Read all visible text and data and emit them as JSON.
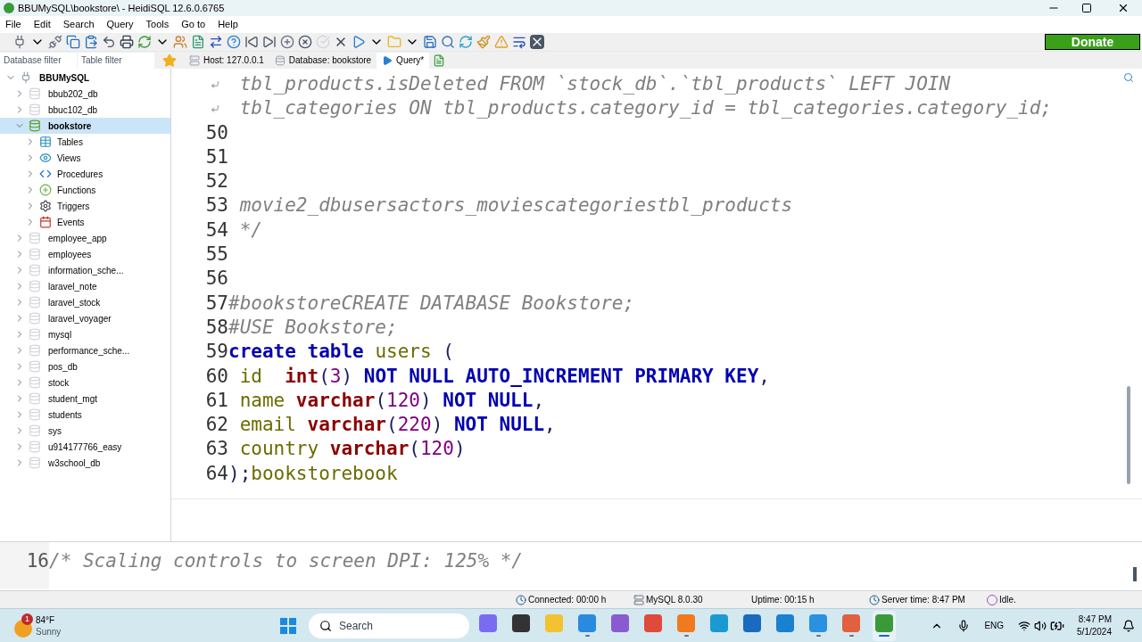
{
  "window": {
    "title": "BBUMySQL\\bookstore\\ - HeidiSQL 12.6.0.6765"
  },
  "menu": [
    "File",
    "Edit",
    "Search",
    "Query",
    "Tools",
    "Go to",
    "Help"
  ],
  "donate": {
    "label": "Donate"
  },
  "filters": [
    {
      "placeholder": "Database filter"
    },
    {
      "placeholder": "Table filter"
    }
  ],
  "tabs": [
    {
      "label": "Host: 127.0.0.1",
      "kind": "host",
      "selected": false
    },
    {
      "label": "Database: bookstore",
      "kind": "database",
      "selected": false
    },
    {
      "label": "Query*",
      "kind": "query",
      "selected": true
    }
  ],
  "tree": {
    "label": "BBUMySQL",
    "expanded": true,
    "children": [
      {
        "label": "bbub202_db",
        "kind": "database",
        "selected": false,
        "expanded": false
      },
      {
        "label": "bbuc102_db",
        "kind": "database",
        "selected": false,
        "expanded": false
      },
      {
        "label": "bookstore",
        "kind": "database",
        "selected": true,
        "expanded": true,
        "children": [
          {
            "label": "Tables",
            "kind": "tables"
          },
          {
            "label": "Views",
            "kind": "views"
          },
          {
            "label": "Procedures",
            "kind": "procedures"
          },
          {
            "label": "Functions",
            "kind": "functions"
          },
          {
            "label": "Triggers",
            "kind": "triggers"
          },
          {
            "label": "Events",
            "kind": "events"
          }
        ]
      },
      {
        "label": "employee_app",
        "kind": "database",
        "selected": false,
        "expanded": false
      },
      {
        "label": "employees",
        "kind": "database",
        "selected": false,
        "expanded": false
      },
      {
        "label": "information_sche...",
        "kind": "database",
        "selected": false,
        "expanded": false
      },
      {
        "label": "laravel_note",
        "kind": "database",
        "selected": false,
        "expanded": false
      },
      {
        "label": "laravel_stock",
        "kind": "database",
        "selected": false,
        "expanded": false
      },
      {
        "label": "laravel_voyager",
        "kind": "database",
        "selected": false,
        "expanded": false
      },
      {
        "label": "mysql",
        "kind": "database",
        "selected": false,
        "expanded": false
      },
      {
        "label": "performance_sche...",
        "kind": "database",
        "selected": false,
        "expanded": false
      },
      {
        "label": "pos_db",
        "kind": "database",
        "selected": false,
        "expanded": false
      },
      {
        "label": "stock",
        "kind": "database",
        "selected": false,
        "expanded": false
      },
      {
        "label": "student_mgt",
        "kind": "database",
        "selected": false,
        "expanded": false
      },
      {
        "label": "students",
        "kind": "database",
        "selected": false,
        "expanded": false
      },
      {
        "label": "sys",
        "kind": "database",
        "selected": false,
        "expanded": false
      },
      {
        "label": "u914177766_easy",
        "kind": "database",
        "selected": false,
        "expanded": false
      },
      {
        "label": "w3school_db",
        "kind": "database",
        "selected": false,
        "expanded": false
      }
    ]
  },
  "editor": {
    "lines": [
      {
        "tokens": [
          {
            "kind": "comment",
            "text": " tbl_products.isDeleted FROM `stock_db`.`tbl_products` LEFT JOIN"
          }
        ]
      },
      {
        "tokens": [
          {
            "kind": "comment",
            "text": " tbl_categories ON tbl_products.category_id = tbl_categories.category_id;"
          }
        ]
      },
      {
        "number": "50"
      },
      {
        "number": "51"
      },
      {
        "number": "52"
      },
      {
        "number": "53",
        "tokens": [
          {
            "kind": "comment",
            "text": " movie2_dbusersactors_moviescategoriestbl_products"
          }
        ]
      },
      {
        "number": "54",
        "tokens": [
          {
            "kind": "comment",
            "text": " */"
          }
        ]
      },
      {
        "number": "55"
      },
      {
        "number": "56"
      },
      {
        "number": "57",
        "tokens": [
          {
            "kind": "comment",
            "text": "#bookstoreCREATE DATABASE Bookstore;"
          }
        ]
      },
      {
        "number": "58",
        "tokens": [
          {
            "kind": "comment",
            "text": "#USE Bookstore;"
          }
        ]
      },
      {
        "number": "59",
        "tokens": [
          {
            "kind": "keyword",
            "text": "create table "
          },
          {
            "kind": "ident",
            "text": "users "
          },
          {
            "kind": "plain",
            "text": "("
          }
        ]
      },
      {
        "number": "60",
        "tokens": [
          {
            "kind": "ident",
            "text": " id  "
          },
          {
            "kind": "type",
            "text": "int"
          },
          {
            "kind": "plain",
            "text": "("
          },
          {
            "kind": "number",
            "text": "3"
          },
          {
            "kind": "plain",
            "text": ") "
          },
          {
            "kind": "keyword",
            "text": "NOT NULL AUTO_INCREMENT PRIMARY KEY"
          },
          {
            "kind": "plain",
            "text": ","
          }
        ]
      },
      {
        "number": "61",
        "tokens": [
          {
            "kind": "ident",
            "text": " name "
          },
          {
            "kind": "type",
            "text": "varchar"
          },
          {
            "kind": "plain",
            "text": "("
          },
          {
            "kind": "number",
            "text": "120"
          },
          {
            "kind": "plain",
            "text": ") "
          },
          {
            "kind": "keyword",
            "text": "NOT NULL"
          },
          {
            "kind": "plain",
            "text": ","
          }
        ]
      },
      {
        "number": "62",
        "tokens": [
          {
            "kind": "ident",
            "text": " email "
          },
          {
            "kind": "type",
            "text": "varchar"
          },
          {
            "kind": "plain",
            "text": "("
          },
          {
            "kind": "number",
            "text": "220"
          },
          {
            "kind": "plain",
            "text": ") "
          },
          {
            "kind": "keyword",
            "text": "NOT NULL"
          },
          {
            "kind": "plain",
            "text": ","
          }
        ]
      },
      {
        "number": "63",
        "tokens": [
          {
            "kind": "ident",
            "text": " country "
          },
          {
            "kind": "type",
            "text": "varchar"
          },
          {
            "kind": "plain",
            "text": "("
          },
          {
            "kind": "number",
            "text": "120"
          },
          {
            "kind": "plain",
            "text": ")"
          }
        ]
      },
      {
        "number": "64",
        "tokens": [
          {
            "kind": "plain",
            "text": ");"
          },
          {
            "kind": "ident",
            "text": "bookstorebook"
          }
        ]
      }
    ]
  },
  "log": {
    "number": "16",
    "text": "/* Scaling controls to screen DPI: 125% */"
  },
  "status_bar": [
    {
      "kind": "clock",
      "text": "Connected: 00:00 h"
    },
    {
      "kind": "server",
      "text": "MySQL 8.0.30"
    },
    {
      "kind": "none",
      "text": "Uptime: 00:15 h"
    },
    {
      "kind": "clock",
      "text": "Server time: 8:47 PM"
    },
    {
      "kind": "idle",
      "text": "Idle."
    }
  ],
  "taskbar": {
    "weather": {
      "badge": "1",
      "temperature": "84°F",
      "condition": "Sunny"
    },
    "search": {
      "placeholder": "Search"
    },
    "apps": [
      {
        "kind": "copilot",
        "running": false,
        "selected": false
      },
      {
        "kind": "terminal",
        "running": false,
        "selected": false
      },
      {
        "kind": "folder",
        "running": false,
        "selected": false
      },
      {
        "kind": "vscode",
        "running": true,
        "selected": false
      },
      {
        "kind": "vstudio",
        "running": false,
        "selected": false
      },
      {
        "kind": "chrome",
        "running": false,
        "selected": false
      },
      {
        "kind": "firefox",
        "running": true,
        "selected": false
      },
      {
        "kind": "edge",
        "running": false,
        "selected": false
      },
      {
        "kind": "store",
        "running": false,
        "selected": false
      },
      {
        "kind": "mail",
        "running": false,
        "selected": false
      },
      {
        "kind": "elephant",
        "running": true,
        "selected": false
      },
      {
        "kind": "slides",
        "running": true,
        "selected": false
      },
      {
        "kind": "heidi",
        "running": true,
        "selected": true
      }
    ],
    "language": "ENG",
    "time": "8:47 PM",
    "date": "5/1/2024"
  }
}
